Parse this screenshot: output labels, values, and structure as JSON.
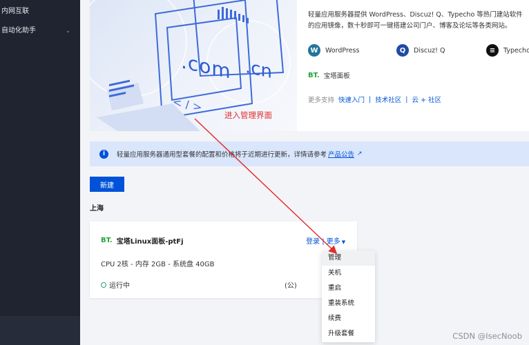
{
  "sidebar": {
    "items": [
      {
        "label": "内网互联"
      },
      {
        "label": "自动化助手",
        "chevron": "chevron-down-icon"
      }
    ]
  },
  "banner": {
    "hero": {
      "text_com": ".com",
      "text_cn": ".cn",
      "text_code": "< / >"
    },
    "intro": "轻量应用服务器提供 WordPress、Discuz! Q、Typecho 等热门建站软件的应用镜像，数十秒即可一键搭建公司门户、博客及论坛等各类网站。",
    "apps": [
      {
        "name": "WordPress",
        "icon": "wordpress-icon",
        "color": "#21759b"
      },
      {
        "name": "Discuz! Q",
        "icon": "discuz-icon",
        "color": "#1f4ba5"
      },
      {
        "name": "Typecho",
        "icon": "typecho-icon",
        "color": "#111111"
      }
    ],
    "bt_logo": "BT.",
    "bt_name": "宝塔面板",
    "support_label": "更多支持",
    "support_links": [
      "快速入门",
      "技术社区",
      "云 + 社区"
    ]
  },
  "notice": {
    "text": "轻量应用服务器通用型套餐的配置和价格将于近期进行更新，详情请参考",
    "link": "产品公告"
  },
  "new_button": "新建",
  "region": "上海",
  "instance": {
    "logo": "BT.",
    "name": "宝塔Linux面板-ptFj",
    "login": "登录",
    "more": "更多",
    "spec": "CPU 2核 - 内存 2GB - 系统盘 40GB",
    "status": "运行中",
    "ip_suffix": "(公)"
  },
  "dropdown": {
    "options": [
      "管理",
      "关机",
      "重启",
      "重装系统",
      "续费",
      "升级套餐"
    ]
  },
  "annotation": "进入管理界面",
  "watermark": "CSDN @IsecNoob",
  "colors": {
    "accent": "#0052d9",
    "annotation": "#e02e2e",
    "bt_green": "#20a53a",
    "running": "#2ba471"
  }
}
